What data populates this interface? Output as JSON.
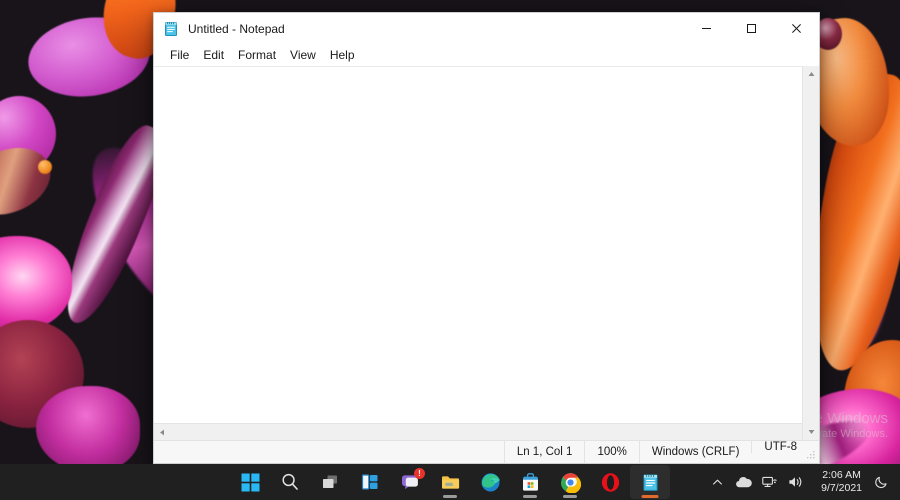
{
  "desktop": {
    "watermark": {
      "line1": "Activate Windows",
      "line2": "Go to Settings to activate Windows."
    }
  },
  "window": {
    "title": "Untitled - Notepad",
    "icon": "notepad-icon",
    "controls": {
      "minimize": "Minimize",
      "maximize": "Maximize",
      "close": "Close"
    },
    "menu": [
      {
        "label": "File"
      },
      {
        "label": "Edit"
      },
      {
        "label": "Format"
      },
      {
        "label": "View"
      },
      {
        "label": "Help"
      }
    ],
    "editor": {
      "content": "",
      "placeholder": ""
    },
    "statusbar": {
      "position": "Ln 1, Col 1",
      "zoom": "100%",
      "line_ending": "Windows (CRLF)",
      "encoding": "UTF-8"
    },
    "scrollbars": {
      "up_arrow": "scroll-up",
      "down_arrow": "scroll-down",
      "left_arrow": "scroll-left"
    }
  },
  "taskbar": {
    "buttons": [
      {
        "name": "start-button",
        "label": "Start",
        "active": false,
        "running": false,
        "badge": null
      },
      {
        "name": "search-button",
        "label": "Search",
        "active": false,
        "running": false,
        "badge": null
      },
      {
        "name": "task-view-button",
        "label": "Task View",
        "active": false,
        "running": false,
        "badge": null
      },
      {
        "name": "widgets-button",
        "label": "Widgets",
        "active": false,
        "running": false,
        "badge": null
      },
      {
        "name": "chat-button",
        "label": "Chat",
        "active": false,
        "running": false,
        "badge": "!"
      },
      {
        "name": "file-explorer-button",
        "label": "File Explorer",
        "active": false,
        "running": true,
        "badge": null
      },
      {
        "name": "edge-button",
        "label": "Microsoft Edge",
        "active": false,
        "running": false,
        "badge": null
      },
      {
        "name": "store-button",
        "label": "Microsoft Store",
        "active": false,
        "running": true,
        "badge": null
      },
      {
        "name": "chrome-button",
        "label": "Google Chrome",
        "active": false,
        "running": true,
        "badge": null
      },
      {
        "name": "opera-button",
        "label": "Opera",
        "active": false,
        "running": false,
        "badge": null
      },
      {
        "name": "notepad-button",
        "label": "Notepad",
        "active": true,
        "running": true,
        "badge": null
      }
    ],
    "tray": {
      "show_hidden": "Show hidden icons",
      "onedrive": "OneDrive",
      "network": "Network",
      "volume": "Volume",
      "time": "2:06 AM",
      "date": "9/7/2021",
      "notifications": "Do not disturb"
    }
  },
  "colors": {
    "accent_orange": "#e06a2b",
    "taskbar_bg": "#202020",
    "window_bg": "#ffffff",
    "badge_red": "#e8342a"
  }
}
